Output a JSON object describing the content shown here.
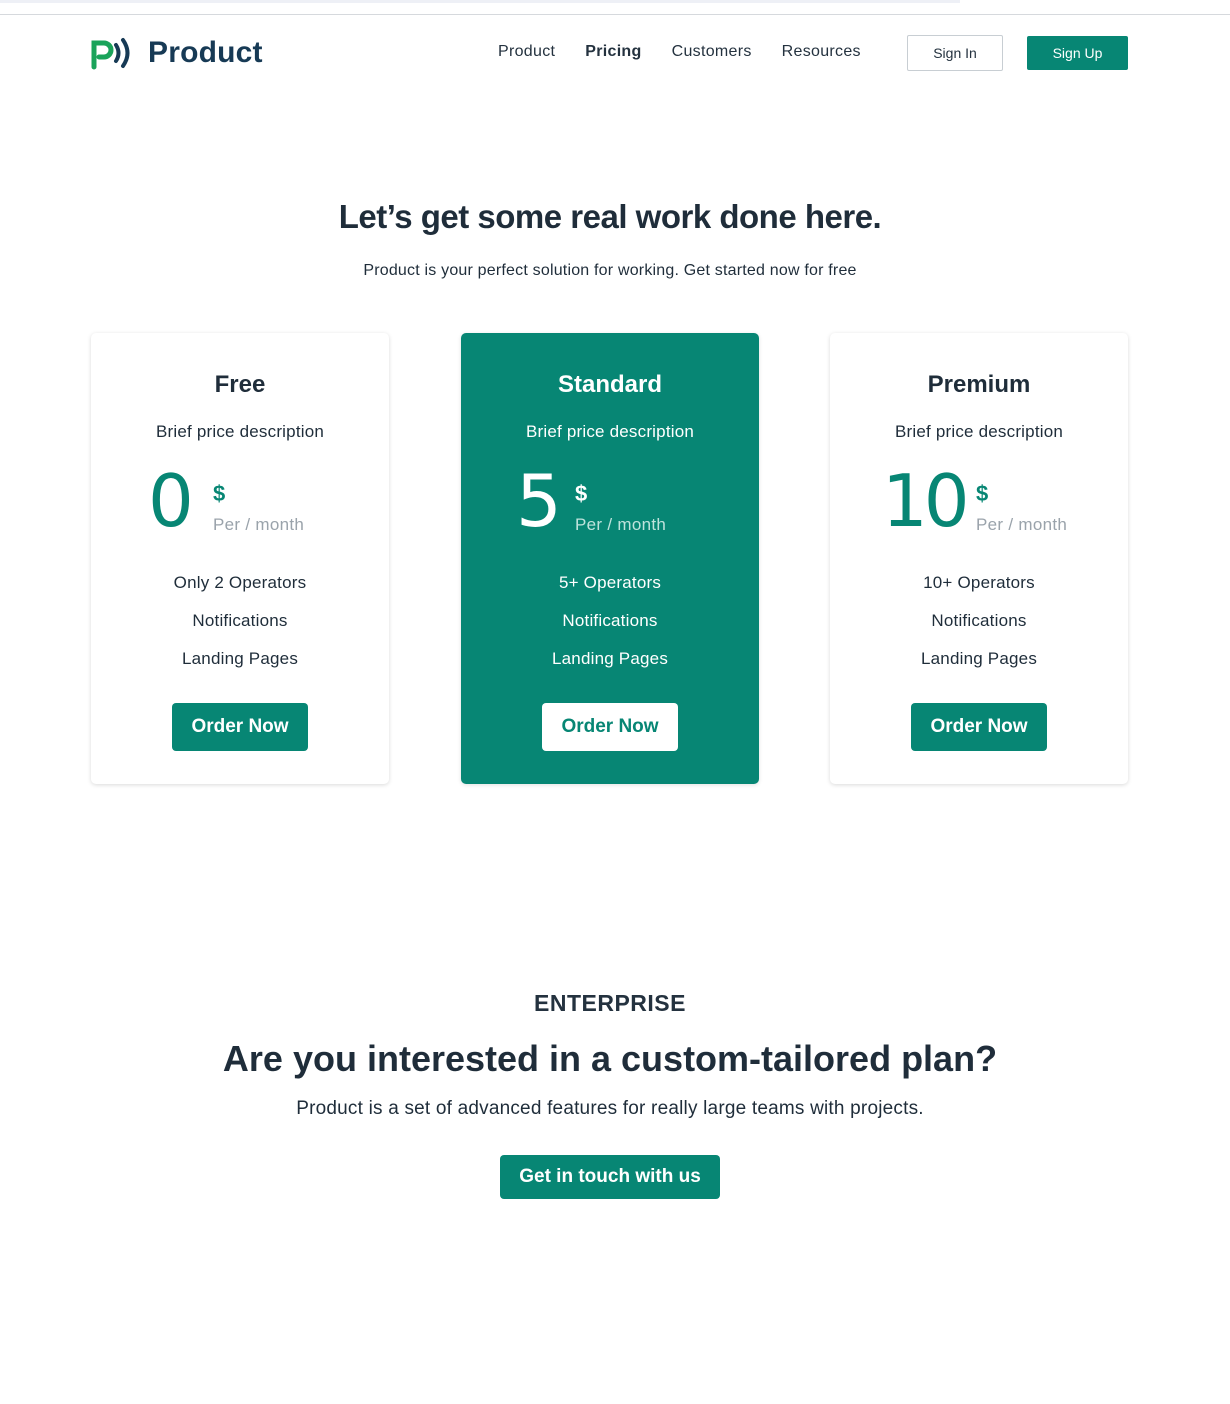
{
  "brand": {
    "name": "Product",
    "accent": "#078674",
    "logo_green": "#1aa35a",
    "logo_dark": "#173a55"
  },
  "nav": {
    "items": [
      {
        "label": "Product",
        "active": false
      },
      {
        "label": "Pricing",
        "active": true
      },
      {
        "label": "Customers",
        "active": false
      },
      {
        "label": "Resources",
        "active": false
      }
    ],
    "signin_label": "Sign In",
    "signup_label": "Sign Up"
  },
  "hero": {
    "title": "Let’s get some real work done here.",
    "subtitle": "Product is your perfect solution for working. Get started now for free"
  },
  "plans": [
    {
      "name": "Free",
      "description": "Brief price description",
      "price": "0",
      "currency": "$",
      "period": "Per / month",
      "features": [
        "Only 2 Operators",
        "Notifications",
        "Landing Pages"
      ],
      "cta": "Order Now",
      "featured": false
    },
    {
      "name": "Standard",
      "description": "Brief price description",
      "price": "5",
      "currency": "$",
      "period": "Per / month",
      "features": [
        "5+ Operators",
        "Notifications",
        "Landing Pages"
      ],
      "cta": "Order Now",
      "featured": true
    },
    {
      "name": "Premium",
      "description": "Brief price description",
      "price": "10",
      "currency": "$",
      "period": "Per / month",
      "features": [
        "10+ Operators",
        "Notifications",
        "Landing Pages"
      ],
      "cta": "Order Now",
      "featured": false
    }
  ],
  "enterprise": {
    "label": "ENTERPRISE",
    "title": "Are you interested in a custom-tailored plan?",
    "subtitle": "Product is a set of advanced features for really large teams with projects.",
    "cta": "Get in touch with us"
  }
}
